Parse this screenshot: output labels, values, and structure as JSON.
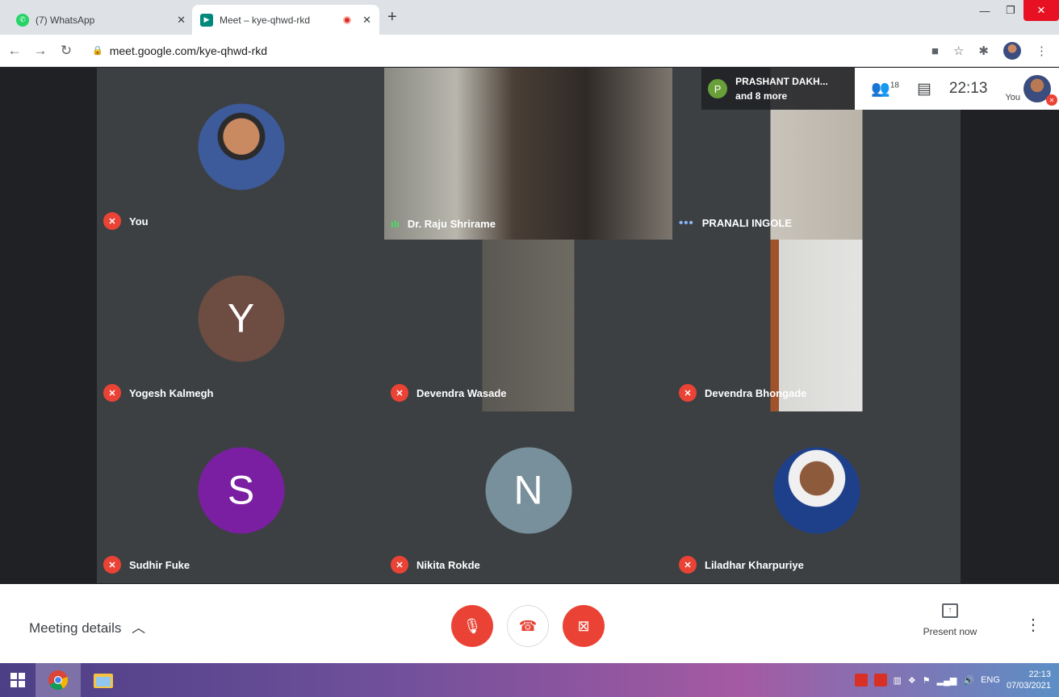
{
  "browser": {
    "tabs": [
      {
        "title": "(7) WhatsApp",
        "active": false
      },
      {
        "title": "Meet – kye-qhwd-rkd",
        "active": true
      }
    ],
    "url": "meet.google.com/kye-qhwd-rkd"
  },
  "meet": {
    "others_label": "PRASHANT DAKH...",
    "others_more": "and 8 more",
    "others_initial": "P",
    "participant_count": "18",
    "time": "22:13",
    "you_label": "You",
    "tiles": [
      {
        "name": "You",
        "status": "muted"
      },
      {
        "name": "Dr. Raju Shrirame",
        "status": "speaking"
      },
      {
        "name": "PRANALI INGOLE",
        "status": "connecting"
      },
      {
        "name": "Yogesh Kalmegh",
        "status": "muted",
        "initial": "Y"
      },
      {
        "name": "Devendra Wasade",
        "status": "muted"
      },
      {
        "name": "Devendra Bhongade",
        "status": "muted"
      },
      {
        "name": "Sudhir Fuke",
        "status": "muted",
        "initial": "S"
      },
      {
        "name": "Nikita Rokde",
        "status": "muted",
        "initial": "N"
      },
      {
        "name": "Liladhar Kharpuriye",
        "status": "muted"
      }
    ],
    "avatar_colors": {
      "Y": "#6d4c41",
      "S": "#7b1fa2",
      "N": "#78909c"
    }
  },
  "controls": {
    "meeting_details": "Meeting details",
    "present_now": "Present now"
  },
  "taskbar": {
    "lang": "ENG",
    "time": "22:13",
    "date": "07/03/2021"
  }
}
